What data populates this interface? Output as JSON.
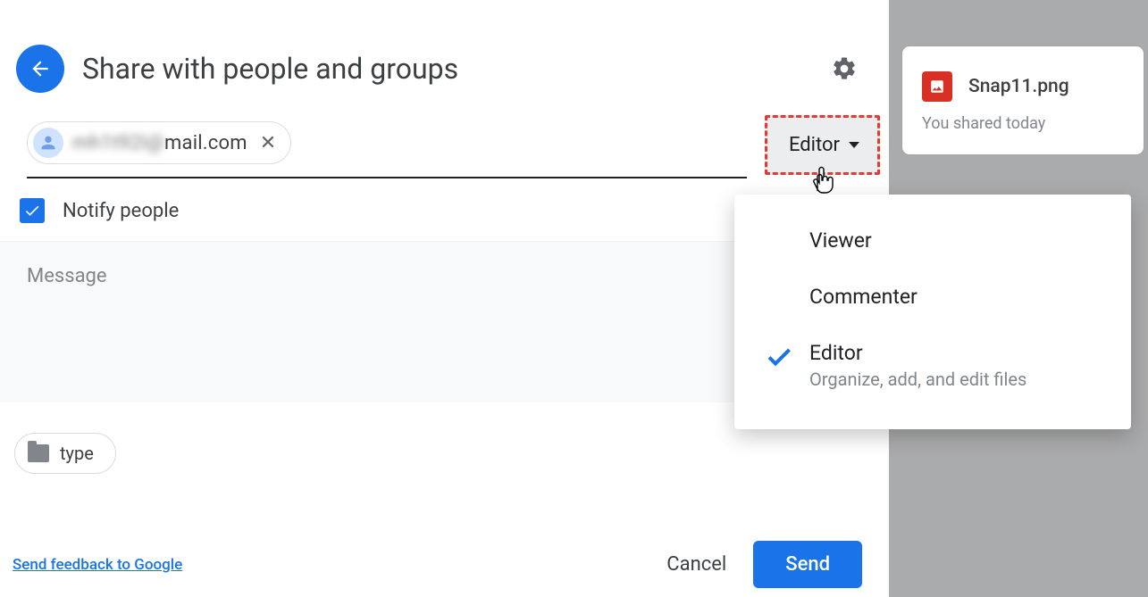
{
  "dialog": {
    "title": "Share with people and groups",
    "recipient_email": "mail.com",
    "recipient_prefix_blurred": "m····@",
    "role_selected": "Editor",
    "notify_label": "Notify people",
    "notify_checked": true,
    "message_placeholder": "Message",
    "type_chip_label": "type",
    "feedback_link": "Send feedback to Google",
    "cancel_label": "Cancel",
    "send_label": "Send"
  },
  "dropdown": {
    "items": [
      {
        "label": "Viewer",
        "desc": "",
        "selected": false
      },
      {
        "label": "Commenter",
        "desc": "",
        "selected": false
      },
      {
        "label": "Editor",
        "desc": "Organize, add, and edit files",
        "selected": true
      }
    ]
  },
  "side": {
    "filename": "Snap11.png",
    "subtitle": "You shared today"
  }
}
